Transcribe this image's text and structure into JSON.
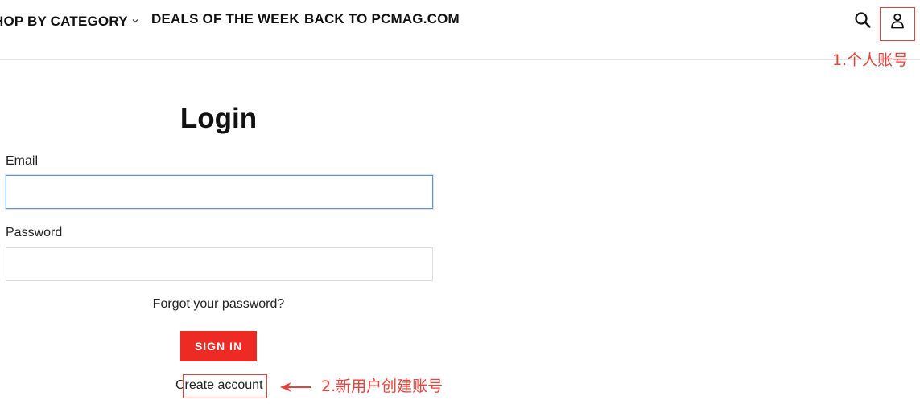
{
  "nav": {
    "items": [
      {
        "label": "HOP BY CATEGORY",
        "has_dropdown": true
      },
      {
        "label": "DEALS OF THE WEEK"
      },
      {
        "label": "BACK TO PCMAG.COM"
      }
    ],
    "icons": {
      "search": "search-icon",
      "account": "user-icon",
      "dropdown": "chevron-down-icon"
    }
  },
  "annotations": {
    "account": "1.个人账号",
    "create": "2.新用户创建账号"
  },
  "login": {
    "title": "Login",
    "email_label": "Email",
    "email_value": "",
    "password_label": "Password",
    "password_value": "",
    "forgot": "Forgot your password?",
    "signin": "SIGN IN",
    "create": "Create account"
  },
  "colors": {
    "accent": "#ee2a24",
    "annotation": "#e8423a",
    "focus_border": "#5c93e6"
  }
}
